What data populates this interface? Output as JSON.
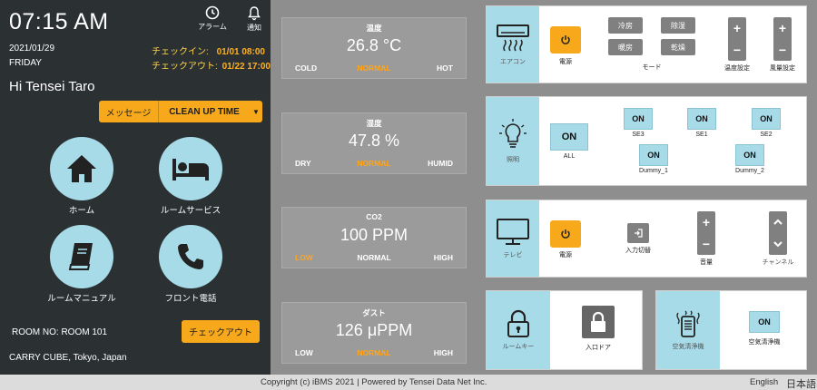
{
  "header": {
    "time": "07:15 AM",
    "date": "2021/01/29",
    "weekday": "FRIDAY",
    "alarm_label": "アラーム",
    "notify_label": "通知",
    "checkin_label": "チェックイン:",
    "checkin_value": "01/01 08:00",
    "checkout_label": "チェックアウト:",
    "checkout_value": "01/22 17:00",
    "greeting": "Hi Tensei Taro"
  },
  "message_bar": {
    "message": "メッセージ",
    "selected": "CLEAN UP TIME"
  },
  "menu": {
    "home": "ホーム",
    "room_service": "ルームサービス",
    "room_manual": "ルームマニュアル",
    "front_phone": "フロント電話"
  },
  "room": {
    "room_no": "ROOM NO: ROOM 101",
    "checkout_button": "チェックアウト",
    "location": "CARRY CUBE, Tokyo, Japan"
  },
  "sensors": [
    {
      "title": "温度",
      "value": "26.8 °C",
      "low": "COLD",
      "mid": "NORMAL",
      "high": "HOT",
      "active": "mid"
    },
    {
      "title": "湿度",
      "value": "47.8 %",
      "low": "DRY",
      "mid": "NORMAL",
      "high": "HUMID",
      "active": "mid"
    },
    {
      "title": "CO2",
      "value": "100 PPM",
      "low": "LOW",
      "mid": "NORMAL",
      "high": "HIGH",
      "active": "low"
    },
    {
      "title": "ダスト",
      "value": "126 μPPM",
      "low": "LOW",
      "mid": "NORMAL",
      "high": "HIGH",
      "active": "mid"
    }
  ],
  "aircon": {
    "label": "エアコン",
    "power_label": "電源",
    "modes": [
      "冷房",
      "除湿",
      "暖房",
      "乾燥"
    ],
    "mode_label": "モード",
    "temp_label": "温度設定",
    "fan_label": "風量設定",
    "plus": "+",
    "minus": "−"
  },
  "lighting": {
    "label": "照明",
    "all_button": "ON",
    "all_label": "ALL",
    "lights": [
      {
        "name": "SE3",
        "state": "ON"
      },
      {
        "name": "SE1",
        "state": "ON"
      },
      {
        "name": "SE2",
        "state": "ON"
      },
      {
        "name": "Dummy_1",
        "state": "ON"
      },
      {
        "name": "Dummy_2",
        "state": "ON"
      }
    ]
  },
  "tv": {
    "label": "テレビ",
    "power_label": "電源",
    "input_label": "入力切替",
    "volume_label": "音量",
    "channel_label": "チャンネル",
    "plus": "+",
    "minus": "−",
    "up": "⌃",
    "down": "⌄"
  },
  "roomkey": {
    "label": "ルームキー",
    "door_label": "入口ドア"
  },
  "purifier": {
    "label": "空気清浄機",
    "button": "ON",
    "button_label": "空気清浄機"
  },
  "footer": {
    "copyright": "Copyright (c) iBMS 2021 | Powered by Tensei Data Net Inc.",
    "english": "English",
    "japanese": "日本語"
  },
  "colors": {
    "accent": "#f7a91b",
    "light_blue": "#a8dbe8",
    "dark": "#2b3033"
  }
}
